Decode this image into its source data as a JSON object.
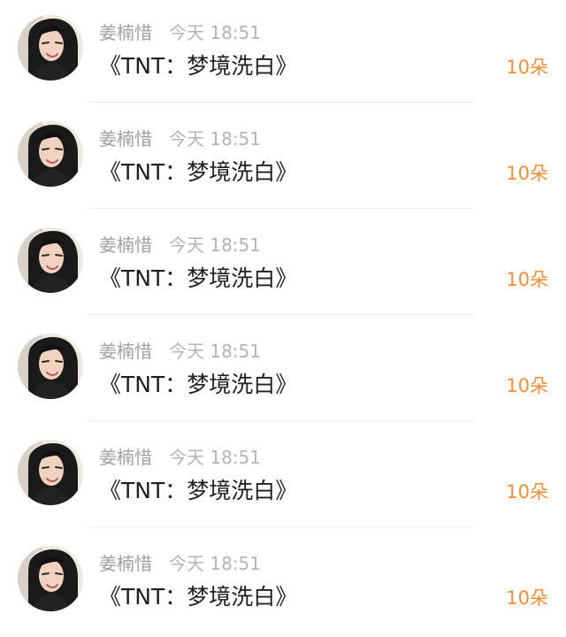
{
  "items": [
    {
      "name": "姜楠惜",
      "time": "今天 18:51",
      "message": "《TNT：梦境洗白》",
      "count": "10朵"
    },
    {
      "name": "姜楠惜",
      "time": "今天 18:51",
      "message": "《TNT：梦境洗白》",
      "count": "10朵"
    },
    {
      "name": "姜楠惜",
      "time": "今天 18:51",
      "message": "《TNT：梦境洗白》",
      "count": "10朵"
    },
    {
      "name": "姜楠惜",
      "time": "今天 18:51",
      "message": "《TNT：梦境洗白》",
      "count": "10朵"
    },
    {
      "name": "姜楠惜",
      "time": "今天 18:51",
      "message": "《TNT：梦境洗白》",
      "count": "10朵"
    },
    {
      "name": "姜楠惜",
      "time": "今天 18:51",
      "message": "《TNT：梦境洗白》",
      "count": "10朵"
    }
  ],
  "avatar_icon": "avatar-portrait",
  "colors": {
    "accent": "#ff8b32",
    "name_text": "#a0a0a0",
    "time_text": "#b4b4b4",
    "message_text": "#1f1f1f",
    "divider": "#efefef"
  }
}
